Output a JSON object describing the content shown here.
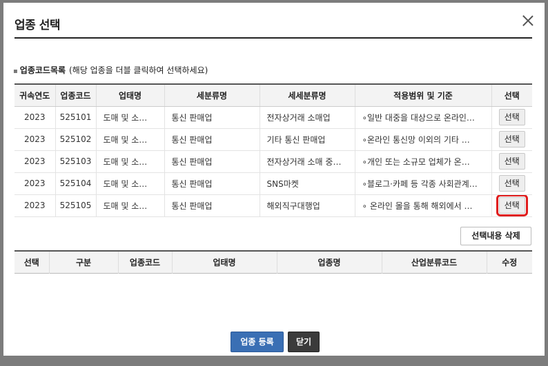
{
  "dialog": {
    "title": "업종 선택",
    "close_icon": "close-icon"
  },
  "section": {
    "title": "업종코드목록",
    "hint": "(해당 업종을 더블 클릭하여 선택하세요)"
  },
  "top_table": {
    "headers": [
      "귀속연도",
      "업종코드",
      "업태명",
      "세분류명",
      "세세분류명",
      "적용범위 및 기준",
      "선택"
    ],
    "rows": [
      {
        "year": "2023",
        "code": "525101",
        "type": "도매 및 소…",
        "sub": "통신 판매업",
        "subsub": "전자상거래 소매업",
        "scope": "∘일반 대중을 대상으로 온라인…",
        "action": "선택"
      },
      {
        "year": "2023",
        "code": "525102",
        "type": "도매 및 소…",
        "sub": "통신 판매업",
        "subsub": "기타 통신 판매업",
        "scope": "∘온라인 통신망 이외의 기타 …",
        "action": "선택"
      },
      {
        "year": "2023",
        "code": "525103",
        "type": "도매 및 소…",
        "sub": "통신 판매업",
        "subsub": "전자상거래 소매 중…",
        "scope": "∘개인 또는 소규모 업체가 온…",
        "action": "선택"
      },
      {
        "year": "2023",
        "code": "525104",
        "type": "도매 및 소…",
        "sub": "통신 판매업",
        "subsub": "SNS마켓",
        "scope": "∘블로그·카페 등 각종 사회관계…",
        "action": "선택"
      },
      {
        "year": "2023",
        "code": "525105",
        "type": "도매 및 소…",
        "sub": "통신 판매업",
        "subsub": "해외직구대행업",
        "scope": "∘ 온라인 몰을 통해 해외에서 …",
        "action": "선택"
      }
    ]
  },
  "delete_button": "선택내용 삭제",
  "bottom_table": {
    "headers": [
      "선택",
      "구분",
      "업종코드",
      "업태명",
      "업종명",
      "산업분류코드",
      "수정"
    ]
  },
  "footer": {
    "register": "업종 등록",
    "close": "닫기"
  },
  "colors": {
    "highlight": "#e01c1c",
    "primary": "#3a6fb4",
    "dark": "#3b3b3b"
  }
}
